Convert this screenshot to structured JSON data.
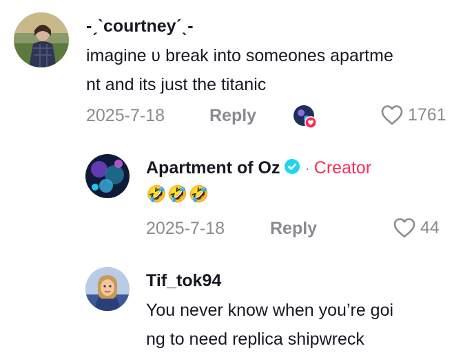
{
  "comments": [
    {
      "username": "-ˏˋcourtneyˊˎ-",
      "text": "imagine ʋ break into someones apartme\nnt and its just the titanic",
      "date": "2025-7-18",
      "reply_label": "Reply",
      "likes": "1761"
    },
    {
      "username": "Apartment of Oz",
      "separator": "·",
      "creator_label": "Creator",
      "text": "🤣🤣🤣",
      "date": "2025-7-18",
      "reply_label": "Reply",
      "likes": "44"
    },
    {
      "username": "Tif_tok94",
      "text": "You never know when you’re goi\nng to need replica shipwreck"
    }
  ],
  "colors": {
    "creator": "#fe2c55",
    "verified": "#20d5ec",
    "meta": "#8a8b91",
    "text": "#161823"
  },
  "icons": [
    "heart-outline-icon",
    "verified-badge-icon",
    "liked-by-creator-icon"
  ]
}
